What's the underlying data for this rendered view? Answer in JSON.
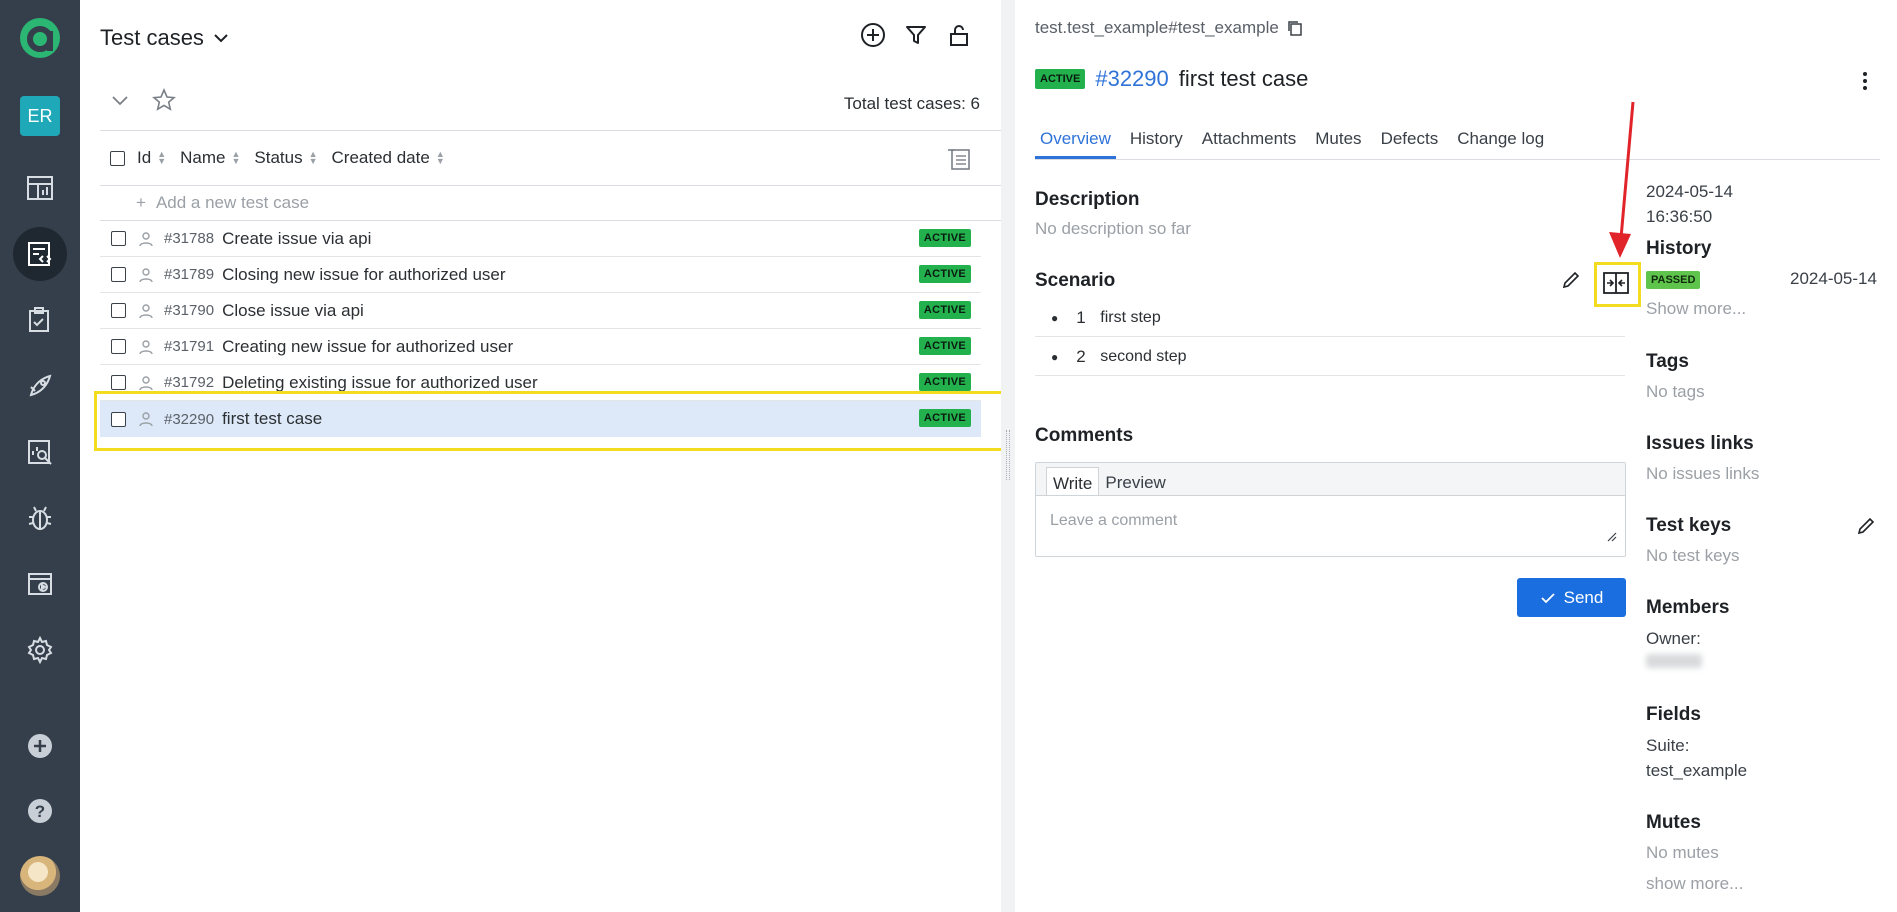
{
  "nav": {
    "user_initials": "ER"
  },
  "left": {
    "title": "Test cases",
    "total_label": "Total test cases: 6",
    "columns": [
      "Id",
      "Name",
      "Status",
      "Created date"
    ],
    "add_label": "Add a new test case",
    "rows": [
      {
        "id": "#31788",
        "name": "Create issue via api",
        "status": "ACTIVE"
      },
      {
        "id": "#31789",
        "name": "Closing new issue for authorized user",
        "status": "ACTIVE"
      },
      {
        "id": "#31790",
        "name": "Close issue via api",
        "status": "ACTIVE"
      },
      {
        "id": "#31791",
        "name": "Creating new issue for authorized user",
        "status": "ACTIVE"
      },
      {
        "id": "#31792",
        "name": "Deleting existing issue for authorized user",
        "status": "ACTIVE"
      },
      {
        "id": "#32290",
        "name": "first test case",
        "status": "ACTIVE"
      }
    ]
  },
  "detail": {
    "path": "test.test_example#test_example",
    "status": "ACTIVE",
    "case_id": "#32290",
    "case_name": "first test case",
    "tabs": [
      "Overview",
      "History",
      "Attachments",
      "Mutes",
      "Defects",
      "Change log"
    ],
    "description_title": "Description",
    "description_empty": "No description so far",
    "scenario_title": "Scenario",
    "steps": [
      {
        "num": "1",
        "text": "first step"
      },
      {
        "num": "2",
        "text": "second step"
      }
    ],
    "comments_title": "Comments",
    "comment_tab_write": "Write",
    "comment_tab_preview": "Preview",
    "comment_placeholder": "Leave a comment",
    "send_label": "Send"
  },
  "sidebar": {
    "date": "2024-05-14",
    "time": "16:36:50",
    "history_title": "History",
    "history_status": "PASSED",
    "history_date": "2024-05-14",
    "show_more": "Show more...",
    "tags_title": "Tags",
    "tags_empty": "No tags",
    "issues_title": "Issues links",
    "issues_empty": "No issues links",
    "keys_title": "Test keys",
    "keys_empty": "No test keys",
    "members_title": "Members",
    "owner_label": "Owner:",
    "fields_title": "Fields",
    "suite_label": "Suite:",
    "suite_value": "test_example",
    "mutes_title": "Mutes",
    "mutes_empty": "No mutes",
    "show_more_lower": "show more..."
  },
  "colors": {
    "nav_bg": "#343f4b",
    "accent_blue": "#2f73d8",
    "active_green": "#22b14c",
    "highlight_yellow": "#f3dc1f",
    "annotation_red": "#e0242a"
  }
}
